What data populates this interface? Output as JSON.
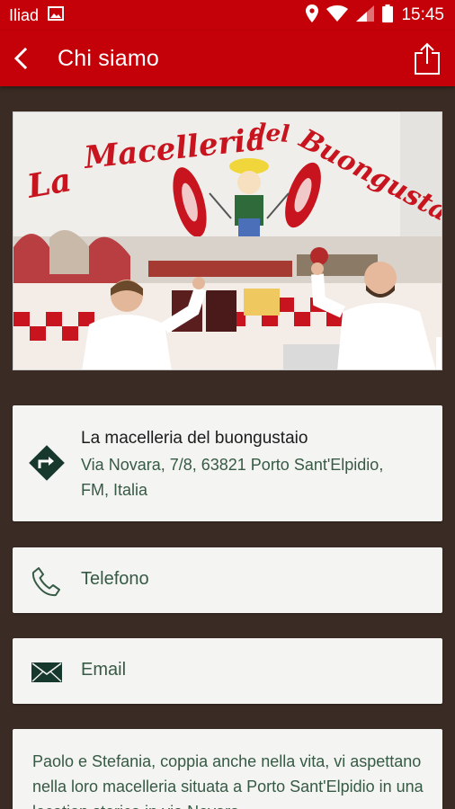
{
  "status_bar": {
    "carrier": "Iliad",
    "time": "15:45"
  },
  "app_bar": {
    "title": "Chi siamo"
  },
  "hero": {
    "sign_text": "La Macelleria del Buongustaio"
  },
  "address": {
    "name": "La macelleria del buongustaio",
    "line1": "Via Novara, 7/8, 63821 Porto Sant'Elpidio,",
    "line2": "FM, Italia"
  },
  "phone": {
    "label": "Telefono"
  },
  "email": {
    "label": "Email"
  },
  "description": {
    "text": "Paolo e Stefania, coppia anche nella vita, vi aspettano nella loro macelleria situata a Porto Sant'Elpidio in una location storica in via Novara"
  },
  "colors": {
    "primary": "#c40008",
    "background": "#3a2c24",
    "accent_text": "#365a44",
    "icon_dark": "#17382c"
  },
  "icons": {
    "back": "arrow-left-icon",
    "share": "share-icon",
    "directions": "directions-icon",
    "phone": "phone-icon",
    "email": "envelope-icon"
  }
}
